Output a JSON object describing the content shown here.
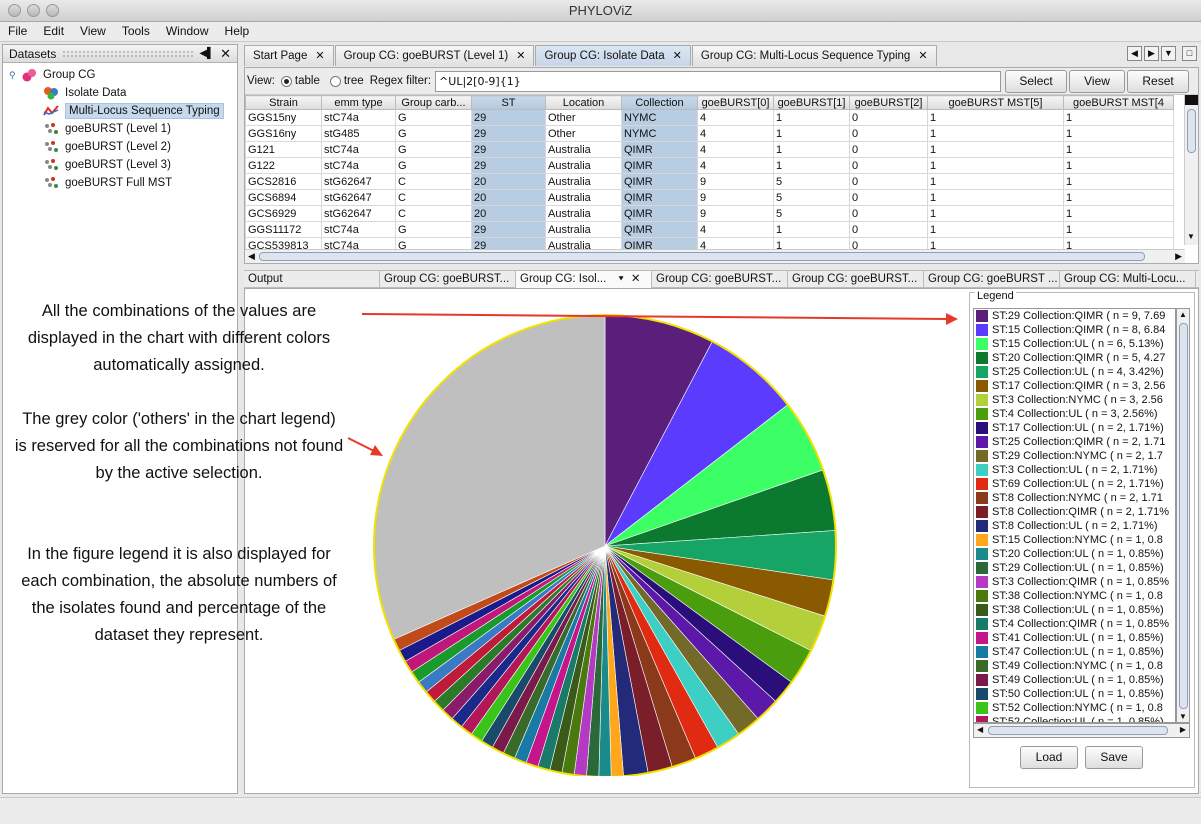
{
  "window": {
    "title": "PHYLOViZ"
  },
  "menu": [
    "File",
    "Edit",
    "View",
    "Tools",
    "Window",
    "Help"
  ],
  "datasets_panel": {
    "title": "Datasets",
    "root": "Group CG",
    "items": [
      "Isolate Data",
      "Multi-Locus Sequence Typing",
      "goeBURST (Level 1)",
      "goeBURST (Level 2)",
      "goeBURST (Level 3)",
      "goeBURST Full MST"
    ]
  },
  "tabs": [
    {
      "label": "Start Page"
    },
    {
      "label": "Group CG: goeBURST (Level 1)"
    },
    {
      "label": "Group CG: Isolate Data"
    },
    {
      "label": "Group CG: Multi-Locus Sequence Typing"
    }
  ],
  "filter": {
    "view_label": "View:",
    "table_label": "table",
    "tree_label": "tree",
    "regex_label": "Regex filter:",
    "regex_value": "^UL|2[0-9]{1}",
    "select_label": "Select",
    "view_btn_label": "View",
    "reset_label": "Reset"
  },
  "table": {
    "columns": [
      "Strain",
      "emm type",
      "Group carb...",
      "ST",
      "Location",
      "Collection",
      "goeBURST[0]",
      "goeBURST[1]",
      "goeBURST[2]",
      "goeBURST MST[5]",
      "goeBURST MST[4"
    ],
    "rows": [
      [
        "GGS15ny",
        "stC74a",
        "G",
        "29",
        "Other",
        "NYMC",
        "4",
        "1",
        "0",
        "1",
        "1"
      ],
      [
        "GGS16ny",
        "stG485",
        "G",
        "29",
        "Other",
        "NYMC",
        "4",
        "1",
        "0",
        "1",
        "1"
      ],
      [
        "G121",
        "stC74a",
        "G",
        "29",
        "Australia",
        "QIMR",
        "4",
        "1",
        "0",
        "1",
        "1"
      ],
      [
        "G122",
        "stC74a",
        "G",
        "29",
        "Australia",
        "QIMR",
        "4",
        "1",
        "0",
        "1",
        "1"
      ],
      [
        "GCS2816",
        "stG62647",
        "C",
        "20",
        "Australia",
        "QIMR",
        "9",
        "5",
        "0",
        "1",
        "1"
      ],
      [
        "GCS6894",
        "stG62647",
        "C",
        "20",
        "Australia",
        "QIMR",
        "9",
        "5",
        "0",
        "1",
        "1"
      ],
      [
        "GCS6929",
        "stG62647",
        "C",
        "20",
        "Australia",
        "QIMR",
        "9",
        "5",
        "0",
        "1",
        "1"
      ],
      [
        "GGS11172",
        "stC74a",
        "G",
        "29",
        "Australia",
        "QIMR",
        "4",
        "1",
        "0",
        "1",
        "1"
      ],
      [
        "GCS539813",
        "stC74a",
        "G",
        "29",
        "Australia",
        "QIMR",
        "4",
        "1",
        "0",
        "1",
        "1"
      ]
    ]
  },
  "output_tabs": [
    "Output",
    "Group CG: goeBURST...",
    "Group CG: Isol...",
    "Group CG: goeBURST...",
    "Group CG: goeBURST...",
    "Group CG: goeBURST ...",
    "Group CG: Multi-Locu..."
  ],
  "annotations": {
    "p1": "All the combinations of the values are displayed in the chart with different colors automatically assigned.",
    "p2": "The grey color  ('others' in the chart legend) is reserved for all the combinations not found by the active selection.",
    "p3": "In the figure legend it is also displayed for each combination, the absolute numbers of the isolates found and percentage of the dataset they represent."
  },
  "legend": {
    "title": "Legend",
    "load_label": "Load",
    "save_label": "Save"
  },
  "chart_data": {
    "type": "pie",
    "slices": [
      {
        "label": "ST:29 Collection:QIMR ( n = 9, 7.69",
        "value": 9,
        "color": "#5a1f7a"
      },
      {
        "label": "ST:15 Collection:QIMR ( n = 8, 6.84",
        "value": 8,
        "color": "#5b3cff"
      },
      {
        "label": "ST:15 Collection:UL ( n = 6, 5.13%)",
        "value": 6,
        "color": "#3cff66"
      },
      {
        "label": "ST:20 Collection:QIMR ( n = 5, 4.27",
        "value": 5,
        "color": "#0b7a2e"
      },
      {
        "label": "ST:25 Collection:UL ( n = 4, 3.42%)",
        "value": 4,
        "color": "#16a565"
      },
      {
        "label": "ST:17 Collection:QIMR ( n = 3, 2.56",
        "value": 3,
        "color": "#8a5a00"
      },
      {
        "label": "ST:3 Collection:NYMC ( n = 3, 2.56",
        "value": 3,
        "color": "#b3cf3a"
      },
      {
        "label": "ST:4 Collection:UL ( n = 3, 2.56%)",
        "value": 3,
        "color": "#4a9e0e"
      },
      {
        "label": "ST:17 Collection:UL ( n = 2, 1.71%)",
        "value": 2,
        "color": "#2a0e7a"
      },
      {
        "label": "ST:25 Collection:QIMR ( n = 2, 1.71",
        "value": 2,
        "color": "#5c18a8"
      },
      {
        "label": "ST:29 Collection:NYMC ( n = 2, 1.7",
        "value": 2,
        "color": "#736a2a"
      },
      {
        "label": "ST:3 Collection:UL ( n = 2, 1.71%)",
        "value": 2,
        "color": "#3ecfc4"
      },
      {
        "label": "ST:69 Collection:UL ( n = 2, 1.71%)",
        "value": 2,
        "color": "#e02a12"
      },
      {
        "label": "ST:8 Collection:NYMC ( n = 2, 1.71",
        "value": 2,
        "color": "#8a3a1a"
      },
      {
        "label": "ST:8 Collection:QIMR ( n = 2, 1.71%",
        "value": 2,
        "color": "#7a1f2a"
      },
      {
        "label": "ST:8 Collection:UL ( n = 2, 1.71%)",
        "value": 2,
        "color": "#232a7a"
      },
      {
        "label": "ST:15 Collection:NYMC ( n = 1, 0.8",
        "value": 1,
        "color": "#ffa61a"
      },
      {
        "label": "ST:20 Collection:UL ( n = 1, 0.85%)",
        "value": 1,
        "color": "#1a8a8a"
      },
      {
        "label": "ST:29 Collection:UL ( n = 1, 0.85%)",
        "value": 1,
        "color": "#2a6a3a"
      },
      {
        "label": "ST:3 Collection:QIMR ( n = 1, 0.85%",
        "value": 1,
        "color": "#b43ac4"
      },
      {
        "label": "ST:38 Collection:NYMC ( n = 1, 0.8",
        "value": 1,
        "color": "#4a7a0e"
      },
      {
        "label": "ST:38 Collection:UL ( n = 1, 0.85%)",
        "value": 1,
        "color": "#3a5a1a"
      },
      {
        "label": "ST:4 Collection:QIMR ( n = 1, 0.85%",
        "value": 1,
        "color": "#1a7a6a"
      },
      {
        "label": "ST:41 Collection:UL ( n = 1, 0.85%)",
        "value": 1,
        "color": "#c4168a"
      },
      {
        "label": "ST:47 Collection:UL ( n = 1, 0.85%)",
        "value": 1,
        "color": "#1a7aa6"
      },
      {
        "label": "ST:49 Collection:NYMC ( n = 1, 0.8",
        "value": 1,
        "color": "#3a6a2a"
      },
      {
        "label": "ST:49 Collection:UL ( n = 1, 0.85%)",
        "value": 1,
        "color": "#7a1a4a"
      },
      {
        "label": "ST:50 Collection:UL ( n = 1, 0.85%)",
        "value": 1,
        "color": "#1a4a6a"
      },
      {
        "label": "ST:52 Collection:NYMC ( n = 1, 0.8",
        "value": 1,
        "color": "#3ac41a"
      },
      {
        "label": "ST:52 Collection:UL ( n = 1, 0.85%)",
        "value": 1,
        "color": "#b4165a"
      },
      {
        "label": "",
        "value": 1,
        "color": "#1a2a8a"
      },
      {
        "label": "",
        "value": 1,
        "color": "#8a1a6a"
      },
      {
        "label": "",
        "value": 1,
        "color": "#2a7a2a"
      },
      {
        "label": "",
        "value": 1,
        "color": "#c01a3a"
      },
      {
        "label": "",
        "value": 1,
        "color": "#3a7ac4"
      },
      {
        "label": "",
        "value": 1,
        "color": "#1a9a2a"
      },
      {
        "label": "",
        "value": 1,
        "color": "#c0187a"
      },
      {
        "label": "",
        "value": 1,
        "color": "#1a1a8a"
      },
      {
        "label": "",
        "value": 1,
        "color": "#c04a1a"
      },
      {
        "label": "others",
        "value": 37,
        "color": "#bfbfbf"
      }
    ]
  }
}
